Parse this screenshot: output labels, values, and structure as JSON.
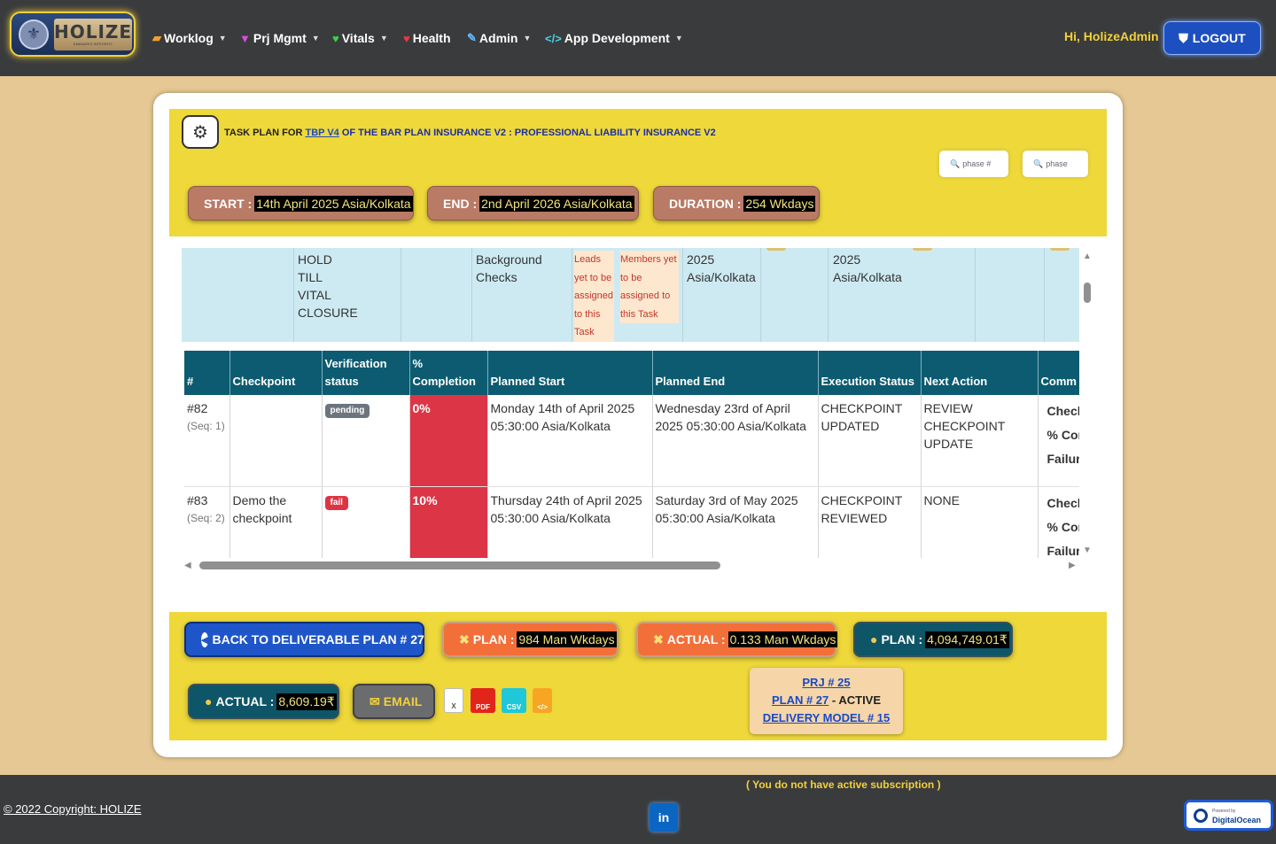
{
  "nav": {
    "logo_text": "HOLIZE",
    "logo_tagline": "EMANATES INTEGRITY",
    "items": [
      {
        "label": "Worklog",
        "has_caret": true
      },
      {
        "label": "Prj Mgmt",
        "has_caret": true
      },
      {
        "label": "Vitals",
        "has_caret": true
      },
      {
        "label": "Health",
        "has_caret": false
      },
      {
        "label": "Admin",
        "has_caret": true
      },
      {
        "label": "App Development",
        "has_caret": true
      }
    ],
    "greeting": "Hi, HolizeAdmin",
    "logout_label": "LOGOUT"
  },
  "header": {
    "title_prefix": "TASK PLAN FOR",
    "title_link": "TBP V4",
    "title_rest": "OF THE BAR PLAN INSURANCE V2 : PROFESSIONAL LIABILITY INSURANCE V2",
    "search_phase_num_placeholder": "phase #",
    "search_phase_placeholder": "phase",
    "start_label": "START :",
    "start_value": "14th April 2025 Asia/Kolkata",
    "end_label": "END :",
    "end_value": "2nd April 2026 Asia/Kolkata",
    "duration_label": "DURATION :",
    "duration_value": "254 Wkdays"
  },
  "previous_row": {
    "col1": [
      "HOLD",
      "TILL",
      "VITAL",
      "CLOSURE"
    ],
    "col2": [
      "Background",
      "Checks"
    ],
    "leads_note": [
      "Leads",
      "yet to be",
      "assigned",
      "to this",
      "Task"
    ],
    "members_note": [
      "Members yet",
      "to be",
      "assigned to",
      "this Task"
    ],
    "col5": [
      "2025",
      "Asia/Kolkata"
    ],
    "col6": [
      "2025",
      "Asia/Kolkata"
    ]
  },
  "table": {
    "headers": [
      "#",
      "Checkpoint",
      "Verification status",
      "% Completion",
      "Planned Start",
      "Planned End",
      "Execution Status",
      "Next Action",
      "Comm"
    ],
    "rows": [
      {
        "num": "#82",
        "seq": "(Seq: 1)",
        "checkpoint": "",
        "status": "pending",
        "completion": "0%",
        "planned_start": "Monday 14th of April 2025 05:30:00 Asia/Kolkata",
        "planned_end": "Wednesday 23rd of April 2025 05:30:00 Asia/Kolkata",
        "execution_status": "CHECKPOINT UPDATED",
        "next_action": "REVIEW CHECKPOINT UPDATE",
        "comments": [
          "Check",
          "% Cor",
          "Failur"
        ]
      },
      {
        "num": "#83",
        "seq": "(Seq: 2)",
        "checkpoint": "Demo the checkpoint",
        "status": "fail",
        "completion": "10%",
        "planned_start": "Thursday 24th of April 2025 05:30:00 Asia/Kolkata",
        "planned_end": "Saturday 3rd of May 2025 05:30:00 Asia/Kolkata",
        "execution_status": "CHECKPOINT REVIEWED",
        "next_action": "NONE",
        "comments": [
          "Check",
          "% Cor",
          "Failur"
        ]
      }
    ]
  },
  "footer_actions": {
    "back_label": "BACK TO DELIVERABLE PLAN # 27",
    "plan_label": "PLAN :",
    "plan_value": "984 Man Wkdays",
    "actual_label": "ACTUAL :",
    "actual_value": "0.133 Man Wkdays",
    "plan_cost_label": "PLAN :",
    "plan_cost_value": "4,094,749.01₹",
    "actual_cost_label": "ACTUAL :",
    "actual_cost_value": "8,609.19₹",
    "email_label": "EMAIL",
    "file_icons": [
      "X",
      "PDF",
      "CSV",
      "</>"
    ],
    "prj_link": "PRJ # 25",
    "plan_link": "PLAN # 27",
    "plan_status": "- ACTIVE",
    "delivery_link": "DELIVERY MODEL # 15"
  },
  "footer": {
    "subscription_note": "( You do not have active subscription )",
    "copyright": "© 2022 Copyright: HOLIZE",
    "linkedin_label": "in",
    "do_powered": "Powered by",
    "do_name": "DigitalOcean"
  },
  "colors": {
    "navbar": "#3a3b3d",
    "page_bg": "#e6c894",
    "yellow_panel": "#eed83a",
    "table_header": "#0c5b71",
    "danger": "#dc3545",
    "accent_blue": "#1e56c9"
  }
}
